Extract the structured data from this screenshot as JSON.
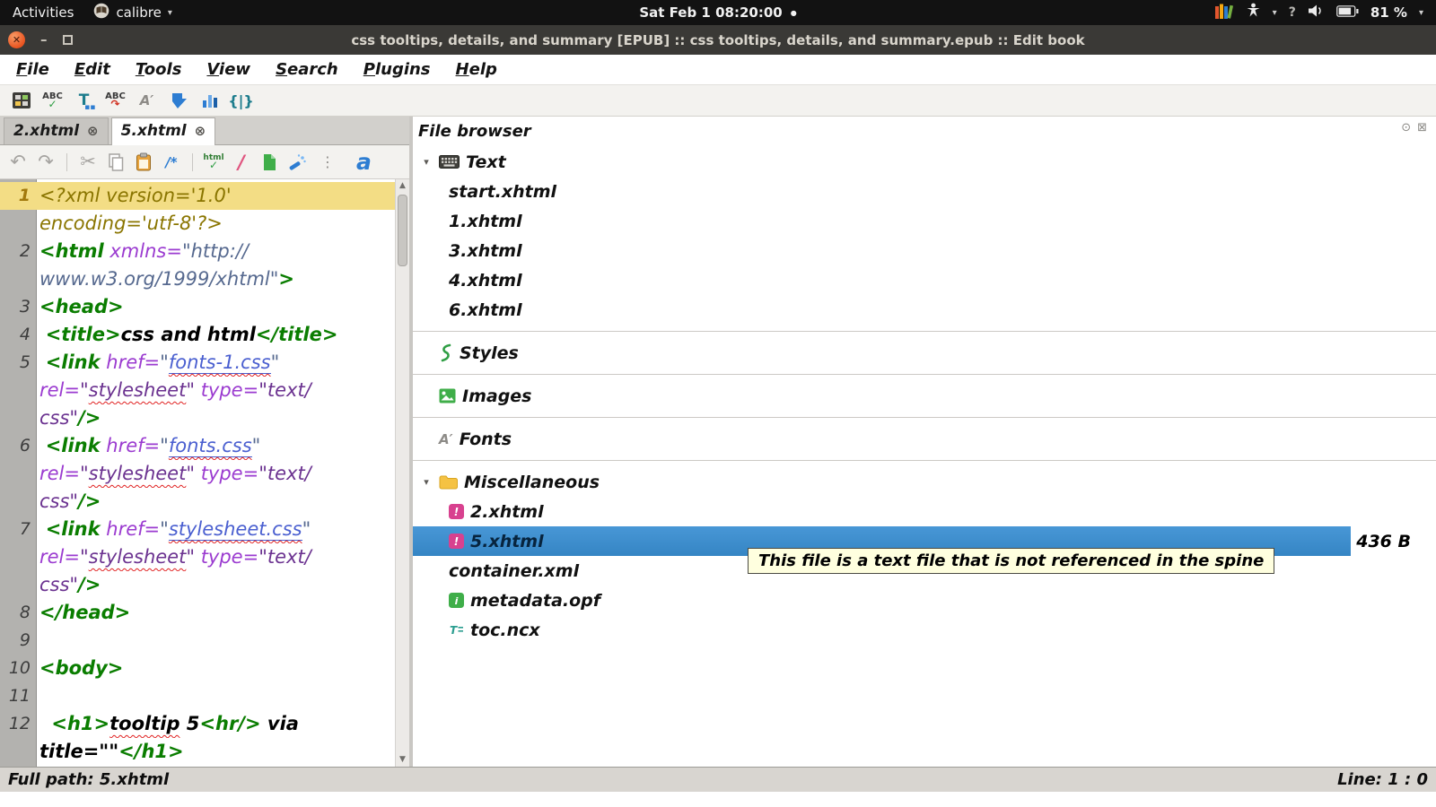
{
  "topbar": {
    "activities": "Activities",
    "app_name": "calibre",
    "clock": "Sat Feb 1  08:20:00",
    "battery": "81 %"
  },
  "titlebar": {
    "title": "css tooltips, details, and summary [EPUB] :: css tooltips, details, and summary.epub :: Edit book"
  },
  "menubar": {
    "items": [
      "File",
      "Edit",
      "Tools",
      "View",
      "Search",
      "Plugins",
      "Help"
    ]
  },
  "main_toolbar": {
    "icons": [
      "check-book-icon",
      "spellcheck-icon",
      "snippets-icon",
      "autofix-icon",
      "fonts-icon",
      "beautify-icon",
      "reports-icon",
      "braces-icon"
    ]
  },
  "editor": {
    "tabs": [
      {
        "label": "2.xhtml",
        "active": false
      },
      {
        "label": "5.xhtml",
        "active": true
      }
    ],
    "toolbar_icons": [
      "undo-icon",
      "redo-icon",
      "sep",
      "cut-icon",
      "copy-icon",
      "paste-icon",
      "comment-icon",
      "sep",
      "fix-html-icon",
      "slash-icon",
      "insert-file-icon",
      "pretty-print-icon",
      "overflow-icon",
      "font-a-icon"
    ],
    "rows": [
      {
        "num": "1",
        "hl": true,
        "segs": [
          {
            "t": "<?xml version='1.0'",
            "c": "pi"
          }
        ]
      },
      {
        "segs": [
          {
            "t": "encoding='utf-8'?>",
            "c": "pi"
          }
        ]
      },
      {
        "num": "2",
        "segs": [
          {
            "t": "<html",
            "c": "tag"
          },
          {
            "t": " ",
            "c": "plain"
          },
          {
            "t": "xmlns=",
            "c": "attr"
          },
          {
            "t": "\"http://",
            "c": "url"
          }
        ]
      },
      {
        "segs": [
          {
            "t": "www.w3.org/1999/xhtml\"",
            "c": "url"
          },
          {
            "t": ">",
            "c": "tag"
          }
        ]
      },
      {
        "num": "3",
        "segs": [
          {
            "t": "<head>",
            "c": "tag"
          }
        ]
      },
      {
        "num": "4",
        "segs": [
          {
            "t": " ",
            "c": "plain"
          },
          {
            "t": "<title>",
            "c": "tag"
          },
          {
            "t": "css and html",
            "c": "text"
          },
          {
            "t": "</title>",
            "c": "tag"
          }
        ]
      },
      {
        "num": "5",
        "segs": [
          {
            "t": " ",
            "c": "plain"
          },
          {
            "t": "<link",
            "c": "tag"
          },
          {
            "t": " ",
            "c": "plain"
          },
          {
            "t": "href=",
            "c": "attr"
          },
          {
            "t": "\"",
            "c": "url"
          },
          {
            "t": "fonts-1.css",
            "c": "href sp"
          },
          {
            "t": "\"",
            "c": "url"
          }
        ]
      },
      {
        "segs": [
          {
            "t": "rel=",
            "c": "attr"
          },
          {
            "t": "\"",
            "c": "val"
          },
          {
            "t": "stylesheet",
            "c": "val sp"
          },
          {
            "t": "\" ",
            "c": "val"
          },
          {
            "t": "type=",
            "c": "attr"
          },
          {
            "t": "\"text/",
            "c": "val"
          }
        ]
      },
      {
        "segs": [
          {
            "t": "css\"",
            "c": "val"
          },
          {
            "t": "/>",
            "c": "tag"
          }
        ]
      },
      {
        "num": "6",
        "segs": [
          {
            "t": " ",
            "c": "plain"
          },
          {
            "t": "<link",
            "c": "tag"
          },
          {
            "t": " ",
            "c": "plain"
          },
          {
            "t": "href=",
            "c": "attr"
          },
          {
            "t": "\"",
            "c": "url"
          },
          {
            "t": "fonts.css",
            "c": "href sp"
          },
          {
            "t": "\"",
            "c": "url"
          }
        ]
      },
      {
        "segs": [
          {
            "t": "rel=",
            "c": "attr"
          },
          {
            "t": "\"",
            "c": "val"
          },
          {
            "t": "stylesheet",
            "c": "val sp"
          },
          {
            "t": "\" ",
            "c": "val"
          },
          {
            "t": "type=",
            "c": "attr"
          },
          {
            "t": "\"text/",
            "c": "val"
          }
        ]
      },
      {
        "segs": [
          {
            "t": "css\"",
            "c": "val"
          },
          {
            "t": "/>",
            "c": "tag"
          }
        ]
      },
      {
        "num": "7",
        "segs": [
          {
            "t": " ",
            "c": "plain"
          },
          {
            "t": "<link",
            "c": "tag"
          },
          {
            "t": " ",
            "c": "plain"
          },
          {
            "t": "href=",
            "c": "attr"
          },
          {
            "t": "\"",
            "c": "url"
          },
          {
            "t": "stylesheet.css",
            "c": "href sp"
          },
          {
            "t": "\"",
            "c": "url"
          }
        ]
      },
      {
        "segs": [
          {
            "t": "rel=",
            "c": "attr"
          },
          {
            "t": "\"",
            "c": "val"
          },
          {
            "t": "stylesheet",
            "c": "val sp"
          },
          {
            "t": "\" ",
            "c": "val"
          },
          {
            "t": "type=",
            "c": "attr"
          },
          {
            "t": "\"text/",
            "c": "val"
          }
        ]
      },
      {
        "segs": [
          {
            "t": "css\"",
            "c": "val"
          },
          {
            "t": "/>",
            "c": "tag"
          }
        ]
      },
      {
        "num": "8",
        "segs": [
          {
            "t": "</head>",
            "c": "tag"
          }
        ]
      },
      {
        "num": "9",
        "segs": []
      },
      {
        "num": "10",
        "segs": [
          {
            "t": "<body>",
            "c": "tag"
          }
        ]
      },
      {
        "num": "11",
        "segs": []
      },
      {
        "num": "12",
        "segs": [
          {
            "t": "  ",
            "c": "plain"
          },
          {
            "t": "<h1>",
            "c": "tag"
          },
          {
            "t": "tooltip",
            "c": "text sp"
          },
          {
            "t": " 5",
            "c": "text"
          },
          {
            "t": "<hr/>",
            "c": "tag"
          },
          {
            "t": " via",
            "c": "text"
          }
        ]
      },
      {
        "segs": [
          {
            "t": "title=\"\"",
            "c": "text"
          },
          {
            "t": "</h1>",
            "c": "tag"
          }
        ]
      }
    ]
  },
  "file_browser": {
    "title": "File browser",
    "tree": [
      {
        "kind": "category",
        "icon": "keyboard-icon",
        "label": "Text",
        "expander": true
      },
      {
        "kind": "file",
        "label": "start.xhtml"
      },
      {
        "kind": "file",
        "label": "1.xhtml"
      },
      {
        "kind": "file",
        "label": "3.xhtml"
      },
      {
        "kind": "file",
        "label": "4.xhtml"
      },
      {
        "kind": "file",
        "label": "6.xhtml"
      },
      {
        "kind": "sep"
      },
      {
        "kind": "category",
        "icon": "styles-icon",
        "label": "Styles"
      },
      {
        "kind": "sep"
      },
      {
        "kind": "category",
        "icon": "images-icon",
        "label": "Images"
      },
      {
        "kind": "sep"
      },
      {
        "kind": "category",
        "icon": "fonts-icon",
        "label": "Fonts"
      },
      {
        "kind": "sep"
      },
      {
        "kind": "category",
        "icon": "folder-icon",
        "label": "Miscellaneous",
        "expander": true
      },
      {
        "kind": "file",
        "icon": "warning-icon",
        "label": "2.xhtml"
      },
      {
        "kind": "file",
        "icon": "warning-icon",
        "label": "5.xhtml",
        "selected": true,
        "size": "436 B"
      },
      {
        "kind": "file",
        "label": "container.xml"
      },
      {
        "kind": "file",
        "icon": "info-icon",
        "label": "metadata.opf"
      },
      {
        "kind": "file",
        "icon": "toc-icon",
        "label": "toc.ncx"
      }
    ],
    "tooltip": "This file is a text file that is not referenced in the spine"
  },
  "statusbar": {
    "left": "Full path: 5.xhtml",
    "right": "Line: 1 : 0"
  }
}
